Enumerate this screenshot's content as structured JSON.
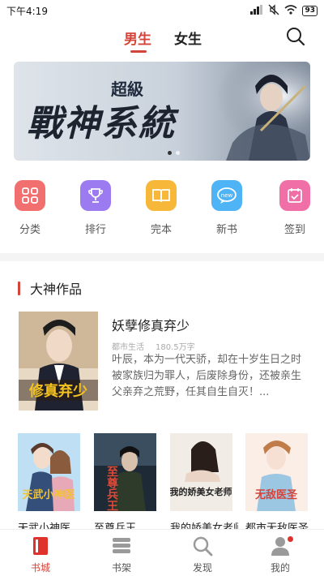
{
  "status_bar": {
    "time": "下午4:19",
    "battery": "93"
  },
  "header": {
    "tabs": [
      "男生",
      "女生"
    ],
    "active_tab": "男生"
  },
  "banner": {
    "small_text": "超級",
    "big_text": "戰神系統",
    "dot_count": 2,
    "active_dot": 0
  },
  "quick_menu": [
    {
      "label": "分类",
      "icon": "grid-icon",
      "color": "#f26f6f"
    },
    {
      "label": "排行",
      "icon": "trophy-icon",
      "color": "#9c7bf0"
    },
    {
      "label": "完本",
      "icon": "book-open-icon",
      "color": "#f7b83a"
    },
    {
      "label": "新书",
      "icon": "new-bubble-icon",
      "color": "#4fb4f5"
    },
    {
      "label": "签到",
      "icon": "calendar-check-icon",
      "color": "#f06fa6"
    }
  ],
  "section": {
    "title": "大神作品"
  },
  "featured_book": {
    "title": "妖孽修真弃少",
    "category": "都市生活",
    "word_count": "180.5万字",
    "description": "叶辰，本为一代天骄，却在十岁生日之时被家族归为罪人，后废除身份，还被亲生父亲弃之荒野，任其自生自灭！...",
    "cover_text": "修真弃少"
  },
  "books": [
    {
      "title": "天武小神医",
      "cover_text": "天武小神医"
    },
    {
      "title": "至尊兵王",
      "cover_text": "至尊兵王"
    },
    {
      "title": "我的娇美女老师",
      "cover_text": "我的娇美女老师"
    },
    {
      "title": "都市无敌医圣",
      "cover_text": "无敌医圣"
    }
  ],
  "bottom_nav": [
    {
      "label": "书城",
      "icon": "bookstore-icon",
      "active": true
    },
    {
      "label": "书架",
      "icon": "bookshelf-icon",
      "active": false
    },
    {
      "label": "发现",
      "icon": "discover-search-icon",
      "active": false
    },
    {
      "label": "我的",
      "icon": "profile-icon",
      "active": false,
      "badge": true
    }
  ],
  "colors": {
    "accent": "#d4443a",
    "muted": "#aaaaaa"
  }
}
